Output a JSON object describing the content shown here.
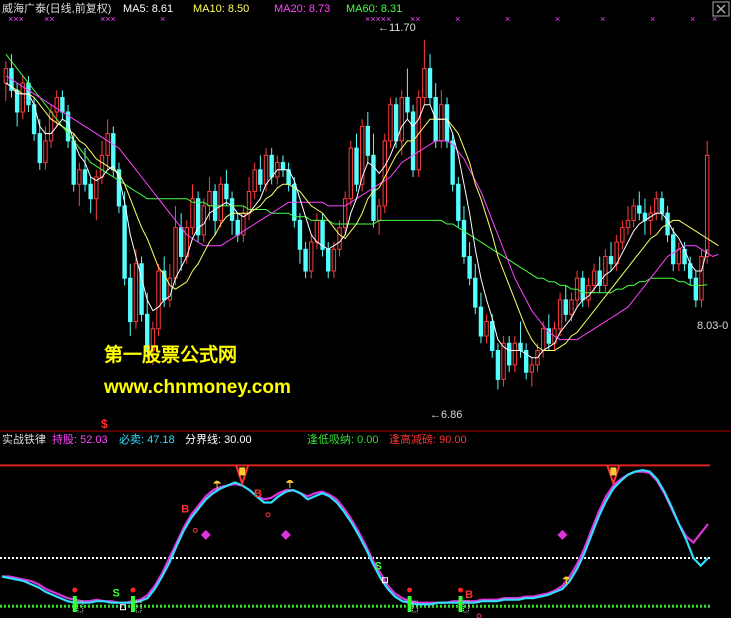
{
  "colors": {
    "background": "#000000",
    "up": "#ff3c3c",
    "down": "#54ffff",
    "ma5": "#ffffff",
    "ma10": "#ffff66",
    "ma20": "#ff44ff",
    "ma60": "#44ff44",
    "divider": "#b00000",
    "red_line": "#dd2222",
    "cyan_line": "#33ddff",
    "magenta_line": "#dd33dd",
    "watermark_yellow": "#ffff00",
    "marker_magenta": "#dd33dd",
    "dotted_white": "#ffffff",
    "dotted_green": "#33dd33",
    "green_bar": "#33ff33"
  },
  "price_panel": {
    "stock_name": "威海广泰(日线,前复权)",
    "ma5_label": "MA5: 8.61",
    "ma10_label": "MA10: 8.50",
    "ma20_label": "MA20: 8.73",
    "ma60_label": "MA60: 8.31",
    "high_label": "←11.70",
    "low_label": "←6.86",
    "last_label": "8.03-0",
    "x_markers": [
      "×××",
      "××",
      "×××",
      "×",
      "×××××",
      "××",
      "×",
      "×",
      "×",
      "×",
      "×",
      "×",
      "×"
    ],
    "dollar_label": "$"
  },
  "watermark": {
    "line1": "第一股票公式网",
    "line2": "www.chnmoney.com"
  },
  "indicator_panel": {
    "name": "实战铁律",
    "hold_label": "持股: 52.03",
    "sell_label": "必卖: 47.18",
    "boundary_label": "分界线: 30.00",
    "buy_low_label": "逢低吸纳: 0.00",
    "sell_high_label": "逢高减磅: 90.00",
    "letters": [
      "S",
      "S",
      "B",
      "B",
      "B"
    ]
  },
  "chart_data": {
    "type": "candlestick",
    "title": "威海广泰(日线,前复权)",
    "price_range": [
      6.3,
      12.0
    ],
    "indicator_range": [
      -5,
      100
    ],
    "grid": false,
    "candles": [
      [
        11.1,
        11.4,
        10.85,
        11.3
      ],
      [
        11.3,
        11.5,
        10.9,
        11.0
      ],
      [
        11.0,
        11.1,
        10.5,
        10.7
      ],
      [
        10.7,
        11.2,
        10.6,
        11.1
      ],
      [
        11.1,
        11.2,
        10.7,
        10.8
      ],
      [
        10.8,
        10.9,
        10.3,
        10.4
      ],
      [
        10.4,
        10.6,
        9.9,
        10.0
      ],
      [
        10.0,
        10.5,
        9.9,
        10.3
      ],
      [
        10.3,
        10.8,
        10.2,
        10.7
      ],
      [
        10.7,
        11.0,
        10.5,
        10.9
      ],
      [
        10.9,
        11.0,
        10.6,
        10.7
      ],
      [
        10.7,
        10.8,
        10.2,
        10.3
      ],
      [
        10.3,
        10.4,
        9.6,
        9.7
      ],
      [
        9.7,
        10.0,
        9.4,
        9.9
      ],
      [
        9.9,
        10.2,
        9.6,
        9.7
      ],
      [
        9.7,
        9.8,
        9.3,
        9.5
      ],
      [
        9.5,
        9.9,
        9.2,
        9.8
      ],
      [
        9.8,
        10.3,
        9.7,
        10.1
      ],
      [
        10.1,
        10.6,
        9.9,
        10.4
      ],
      [
        10.4,
        10.5,
        9.8,
        9.9
      ],
      [
        9.9,
        10.0,
        9.3,
        9.4
      ],
      [
        9.4,
        9.6,
        8.3,
        8.4
      ],
      [
        8.4,
        8.6,
        7.6,
        7.8
      ],
      [
        7.8,
        8.8,
        7.7,
        8.6
      ],
      [
        8.6,
        8.7,
        7.8,
        7.9
      ],
      [
        7.9,
        8.2,
        7.3,
        7.4
      ],
      [
        7.4,
        7.8,
        7.2,
        7.7
      ],
      [
        7.7,
        8.6,
        7.6,
        8.5
      ],
      [
        8.5,
        8.7,
        8.0,
        8.1
      ],
      [
        8.1,
        8.6,
        8.0,
        8.4
      ],
      [
        8.4,
        9.4,
        8.3,
        9.1
      ],
      [
        9.1,
        9.3,
        8.5,
        8.7
      ],
      [
        8.7,
        9.2,
        8.6,
        9.1
      ],
      [
        9.1,
        9.7,
        9.0,
        9.5
      ],
      [
        9.5,
        9.6,
        8.9,
        9.0
      ],
      [
        9.0,
        9.5,
        8.9,
        9.4
      ],
      [
        9.4,
        9.8,
        9.2,
        9.6
      ],
      [
        9.6,
        9.7,
        9.0,
        9.2
      ],
      [
        9.2,
        9.8,
        9.1,
        9.7
      ],
      [
        9.7,
        9.9,
        9.4,
        9.5
      ],
      [
        9.5,
        9.6,
        9.0,
        9.2
      ],
      [
        9.2,
        9.3,
        8.9,
        9.0
      ],
      [
        9.0,
        9.4,
        8.9,
        9.3
      ],
      [
        9.3,
        9.8,
        9.2,
        9.6
      ],
      [
        9.6,
        10.0,
        9.5,
        9.9
      ],
      [
        9.9,
        10.1,
        9.6,
        9.7
      ],
      [
        9.7,
        10.2,
        9.6,
        10.1
      ],
      [
        10.1,
        10.2,
        9.7,
        9.8
      ],
      [
        9.8,
        10.1,
        9.7,
        10.0
      ],
      [
        10.0,
        10.1,
        9.8,
        9.9
      ],
      [
        9.9,
        10.0,
        9.6,
        9.7
      ],
      [
        9.7,
        9.8,
        9.1,
        9.2
      ],
      [
        9.2,
        9.3,
        8.6,
        8.8
      ],
      [
        8.8,
        8.9,
        8.4,
        8.5
      ],
      [
        8.5,
        9.0,
        8.4,
        8.9
      ],
      [
        8.9,
        9.3,
        8.8,
        9.2
      ],
      [
        9.2,
        9.3,
        8.7,
        8.8
      ],
      [
        8.8,
        8.9,
        8.4,
        8.5
      ],
      [
        8.5,
        8.9,
        8.4,
        8.8
      ],
      [
        8.8,
        9.2,
        8.7,
        9.1
      ],
      [
        9.1,
        9.6,
        9.0,
        9.5
      ],
      [
        9.5,
        10.3,
        9.4,
        10.2
      ],
      [
        10.2,
        10.4,
        9.6,
        9.7
      ],
      [
        9.7,
        10.6,
        9.6,
        10.5
      ],
      [
        10.5,
        10.7,
        10.0,
        10.1
      ],
      [
        10.1,
        10.4,
        9.1,
        9.2
      ],
      [
        9.2,
        9.5,
        9.0,
        9.4
      ],
      [
        9.4,
        10.4,
        9.3,
        10.3
      ],
      [
        10.3,
        10.9,
        10.2,
        10.8
      ],
      [
        10.8,
        10.9,
        10.2,
        10.3
      ],
      [
        10.3,
        11.0,
        10.1,
        10.9
      ],
      [
        10.9,
        11.3,
        10.6,
        10.7
      ],
      [
        10.7,
        10.8,
        9.8,
        9.9
      ],
      [
        9.9,
        11.0,
        9.8,
        10.9
      ],
      [
        10.9,
        11.7,
        10.8,
        11.3
      ],
      [
        11.3,
        11.5,
        10.8,
        10.9
      ],
      [
        10.9,
        11.1,
        10.2,
        10.3
      ],
      [
        10.3,
        11.0,
        10.2,
        10.8
      ],
      [
        10.8,
        10.9,
        10.2,
        10.3
      ],
      [
        10.3,
        10.4,
        9.6,
        9.7
      ],
      [
        9.7,
        9.8,
        9.1,
        9.2
      ],
      [
        9.2,
        9.4,
        8.6,
        8.7
      ],
      [
        8.7,
        8.9,
        8.3,
        8.4
      ],
      [
        8.4,
        8.6,
        7.9,
        8.0
      ],
      [
        8.0,
        8.2,
        7.5,
        7.6
      ],
      [
        7.6,
        7.9,
        7.5,
        7.8
      ],
      [
        7.8,
        7.9,
        7.3,
        7.4
      ],
      [
        7.4,
        7.5,
        6.86,
        7.0
      ],
      [
        7.0,
        7.6,
        6.9,
        7.5
      ],
      [
        7.5,
        7.6,
        7.1,
        7.2
      ],
      [
        7.2,
        7.6,
        7.1,
        7.5
      ],
      [
        7.5,
        7.8,
        7.3,
        7.4
      ],
      [
        7.4,
        7.5,
        7.0,
        7.1
      ],
      [
        7.1,
        7.3,
        6.9,
        7.2
      ],
      [
        7.2,
        7.5,
        7.1,
        7.4
      ],
      [
        7.4,
        7.8,
        7.3,
        7.7
      ],
      [
        7.7,
        7.9,
        7.4,
        7.5
      ],
      [
        7.5,
        7.8,
        7.4,
        7.7
      ],
      [
        7.7,
        8.2,
        7.6,
        8.1
      ],
      [
        8.1,
        8.3,
        7.8,
        7.9
      ],
      [
        7.9,
        8.2,
        7.8,
        8.1
      ],
      [
        8.1,
        8.5,
        8.0,
        8.4
      ],
      [
        8.4,
        8.5,
        8.0,
        8.1
      ],
      [
        8.1,
        8.4,
        8.0,
        8.3
      ],
      [
        8.3,
        8.6,
        8.2,
        8.5
      ],
      [
        8.5,
        8.7,
        8.2,
        8.3
      ],
      [
        8.3,
        8.8,
        8.2,
        8.7
      ],
      [
        8.7,
        8.9,
        8.5,
        8.6
      ],
      [
        8.6,
        9.0,
        8.5,
        8.9
      ],
      [
        8.9,
        9.2,
        8.8,
        9.1
      ],
      [
        9.1,
        9.4,
        9.0,
        9.2
      ],
      [
        9.2,
        9.5,
        9.1,
        9.4
      ],
      [
        9.4,
        9.6,
        9.2,
        9.3
      ],
      [
        9.3,
        9.5,
        9.0,
        9.2
      ],
      [
        9.2,
        9.4,
        9.0,
        9.3
      ],
      [
        9.3,
        9.6,
        9.2,
        9.5
      ],
      [
        9.5,
        9.6,
        9.2,
        9.3
      ],
      [
        9.3,
        9.4,
        8.9,
        9.0
      ],
      [
        9.0,
        9.1,
        8.5,
        8.6
      ],
      [
        8.6,
        8.9,
        8.5,
        8.8
      ],
      [
        8.8,
        8.9,
        8.5,
        8.6
      ],
      [
        8.6,
        8.7,
        8.3,
        8.4
      ],
      [
        8.4,
        8.5,
        8.0,
        8.1
      ],
      [
        8.1,
        8.8,
        8.0,
        8.7
      ],
      [
        8.7,
        10.3,
        8.6,
        10.1
      ]
    ],
    "ma5": [
      11.1,
      11.05,
      10.95,
      10.95,
      10.95,
      10.8,
      10.5,
      10.4,
      10.4,
      10.5,
      10.6,
      10.55,
      10.3,
      10.1,
      10.0,
      9.8,
      9.75,
      9.8,
      9.9,
      9.95,
      9.8,
      9.45,
      9.0,
      8.7,
      8.4,
      8.1,
      7.95,
      8.0,
      8.1,
      8.15,
      8.4,
      8.55,
      8.7,
      8.95,
      9.1,
      9.15,
      9.3,
      9.35,
      9.4,
      9.45,
      9.4,
      9.3,
      9.25,
      9.3,
      9.4,
      9.5,
      9.7,
      9.8,
      9.9,
      9.9,
      9.9,
      9.75,
      9.5,
      9.25,
      9.0,
      8.9,
      8.85,
      8.8,
      8.85,
      8.9,
      9.0,
      9.3,
      9.5,
      9.8,
      10.0,
      9.95,
      9.85,
      9.95,
      10.1,
      10.3,
      10.5,
      10.6,
      10.5,
      10.6,
      10.8,
      10.8,
      10.6,
      10.6,
      10.6,
      10.4,
      10.1,
      9.7,
      9.3,
      8.8,
      8.4,
      8.1,
      7.85,
      7.55,
      7.45,
      7.4,
      7.4,
      7.4,
      7.35,
      7.3,
      7.3,
      7.4,
      7.45,
      7.5,
      7.65,
      7.75,
      7.85,
      8.0,
      8.1,
      8.15,
      8.25,
      8.35,
      8.45,
      8.5,
      8.6,
      8.75,
      8.9,
      9.05,
      9.15,
      9.2,
      9.25,
      9.3,
      9.3,
      9.2,
      9.05,
      8.95,
      8.8,
      8.6,
      8.5,
      8.5,
      8.8
    ],
    "ma10": [
      11.1,
      11.05,
      11.0,
      10.95,
      10.95,
      10.9,
      10.8,
      10.7,
      10.6,
      10.55,
      10.5,
      10.45,
      10.4,
      10.3,
      10.25,
      10.15,
      10.05,
      10.0,
      9.95,
      9.9,
      9.85,
      9.7,
      9.5,
      9.3,
      9.1,
      8.95,
      8.75,
      8.55,
      8.45,
      8.3,
      8.25,
      8.3,
      8.35,
      8.5,
      8.6,
      8.75,
      8.9,
      9.0,
      9.15,
      9.25,
      9.3,
      9.3,
      9.3,
      9.3,
      9.35,
      9.4,
      9.5,
      9.55,
      9.65,
      9.7,
      9.7,
      9.65,
      9.6,
      9.5,
      9.4,
      9.35,
      9.3,
      9.2,
      9.1,
      9.0,
      8.95,
      9.05,
      9.15,
      9.3,
      9.5,
      9.6,
      9.65,
      9.8,
      9.95,
      10.1,
      10.2,
      10.3,
      10.3,
      10.4,
      10.5,
      10.6,
      10.6,
      10.6,
      10.6,
      10.5,
      10.4,
      10.2,
      10.0,
      9.7,
      9.5,
      9.25,
      9.0,
      8.7,
      8.5,
      8.3,
      8.1,
      7.9,
      7.7,
      7.55,
      7.45,
      7.4,
      7.4,
      7.4,
      7.45,
      7.5,
      7.6,
      7.65,
      7.75,
      7.85,
      7.95,
      8.05,
      8.15,
      8.25,
      8.35,
      8.45,
      8.55,
      8.65,
      8.75,
      8.85,
      8.95,
      9.0,
      9.1,
      9.15,
      9.2,
      9.2,
      9.15,
      9.1,
      9.05,
      9.0,
      8.95,
      8.9,
      8.85
    ],
    "ma20": [
      11.2,
      11.15,
      11.1,
      11.05,
      11.0,
      10.95,
      10.9,
      10.85,
      10.8,
      10.75,
      10.7,
      10.65,
      10.6,
      10.55,
      10.5,
      10.45,
      10.4,
      10.35,
      10.3,
      10.25,
      10.2,
      10.1,
      10.0,
      9.9,
      9.8,
      9.7,
      9.6,
      9.5,
      9.4,
      9.3,
      9.2,
      9.1,
      9.0,
      8.95,
      8.9,
      8.85,
      8.85,
      8.85,
      8.85,
      8.9,
      8.95,
      9.0,
      9.05,
      9.1,
      9.15,
      9.2,
      9.25,
      9.3,
      9.35,
      9.4,
      9.45,
      9.45,
      9.45,
      9.45,
      9.45,
      9.45,
      9.45,
      9.4,
      9.4,
      9.4,
      9.4,
      9.45,
      9.5,
      9.55,
      9.6,
      9.65,
      9.7,
      9.75,
      9.8,
      9.9,
      10.0,
      10.05,
      10.1,
      10.15,
      10.2,
      10.25,
      10.3,
      10.3,
      10.3,
      10.25,
      10.15,
      10.05,
      9.9,
      9.75,
      9.6,
      9.4,
      9.2,
      9.0,
      8.8,
      8.6,
      8.4,
      8.25,
      8.1,
      7.95,
      7.85,
      7.75,
      7.65,
      7.6,
      7.55,
      7.55,
      7.55,
      7.55,
      7.6,
      7.65,
      7.7,
      7.75,
      7.8,
      7.85,
      7.9,
      7.95,
      8.0,
      8.1,
      8.2,
      8.3,
      8.4,
      8.5,
      8.6,
      8.7,
      8.75,
      8.8,
      8.85,
      8.85,
      8.85,
      8.8,
      8.75,
      8.7,
      8.73
    ],
    "ma60": [
      11.5,
      11.4,
      11.3,
      11.2,
      11.1,
      11.0,
      10.9,
      10.8,
      10.7,
      10.6,
      10.5,
      10.4,
      10.3,
      10.2,
      10.1,
      10.0,
      9.95,
      9.9,
      9.85,
      9.8,
      9.75,
      9.7,
      9.65,
      9.6,
      9.55,
      9.5,
      9.5,
      9.5,
      9.5,
      9.5,
      9.5,
      9.5,
      9.5,
      9.45,
      9.45,
      9.45,
      9.4,
      9.4,
      9.4,
      9.4,
      9.4,
      9.4,
      9.4,
      9.35,
      9.35,
      9.35,
      9.35,
      9.3,
      9.3,
      9.3,
      9.3,
      9.25,
      9.25,
      9.25,
      9.2,
      9.2,
      9.2,
      9.2,
      9.15,
      9.15,
      9.15,
      9.15,
      9.15,
      9.15,
      9.15,
      9.15,
      9.2,
      9.2,
      9.2,
      9.2,
      9.2,
      9.2,
      9.2,
      9.2,
      9.2,
      9.2,
      9.2,
      9.2,
      9.15,
      9.15,
      9.1,
      9.05,
      9.0,
      8.95,
      8.9,
      8.85,
      8.8,
      8.75,
      8.7,
      8.65,
      8.6,
      8.55,
      8.5,
      8.45,
      8.4,
      8.4,
      8.35,
      8.35,
      8.3,
      8.3,
      8.25,
      8.25,
      8.2,
      8.2,
      8.2,
      8.2,
      8.2,
      8.2,
      8.25,
      8.25,
      8.3,
      8.3,
      8.35,
      8.35,
      8.4,
      8.4,
      8.4,
      8.4,
      8.4,
      8.35,
      8.35,
      8.3,
      8.3,
      8.3,
      8.31
    ],
    "indicator": {
      "hold": [
        18,
        18,
        17,
        16,
        15,
        13,
        10,
        8,
        6,
        4,
        3,
        2,
        2,
        3,
        2,
        2,
        1,
        1,
        2,
        3,
        6,
        12,
        20,
        30,
        40,
        50,
        58,
        64,
        70,
        74,
        76,
        77,
        78,
        77,
        74,
        70,
        68,
        69,
        72,
        74,
        74,
        72,
        70,
        72,
        73,
        71,
        68,
        62,
        55,
        47,
        38,
        28,
        20,
        12,
        7,
        4,
        2,
        1,
        1,
        1,
        1,
        1,
        2,
        2,
        2,
        2,
        3,
        3,
        3,
        4,
        4,
        4,
        5,
        5,
        6,
        7,
        9,
        12,
        18,
        26,
        36,
        48,
        60,
        70,
        77,
        81,
        84,
        86,
        86,
        85,
        80,
        72,
        62,
        52,
        44,
        40,
        46,
        52
      ],
      "sell": [
        18,
        17,
        16,
        15,
        13,
        11,
        8,
        6,
        4,
        2,
        1,
        1,
        1,
        2,
        2,
        1,
        1,
        1,
        1,
        2,
        4,
        10,
        18,
        27,
        38,
        48,
        56,
        62,
        68,
        72,
        75,
        77,
        79,
        77,
        74,
        70,
        66,
        66,
        70,
        73,
        74,
        72,
        68,
        70,
        72,
        70,
        66,
        60,
        53,
        45,
        36,
        26,
        17,
        10,
        5,
        2,
        1,
        0,
        0,
        0,
        1,
        1,
        1,
        1,
        1,
        1,
        2,
        2,
        2,
        3,
        3,
        3,
        4,
        4,
        5,
        6,
        8,
        10,
        15,
        23,
        33,
        45,
        57,
        67,
        75,
        80,
        84,
        86,
        87,
        86,
        81,
        73,
        63,
        52,
        42,
        30,
        25,
        30
      ],
      "boundary": 30,
      "buy_low": 0,
      "sell_high": 90
    }
  }
}
